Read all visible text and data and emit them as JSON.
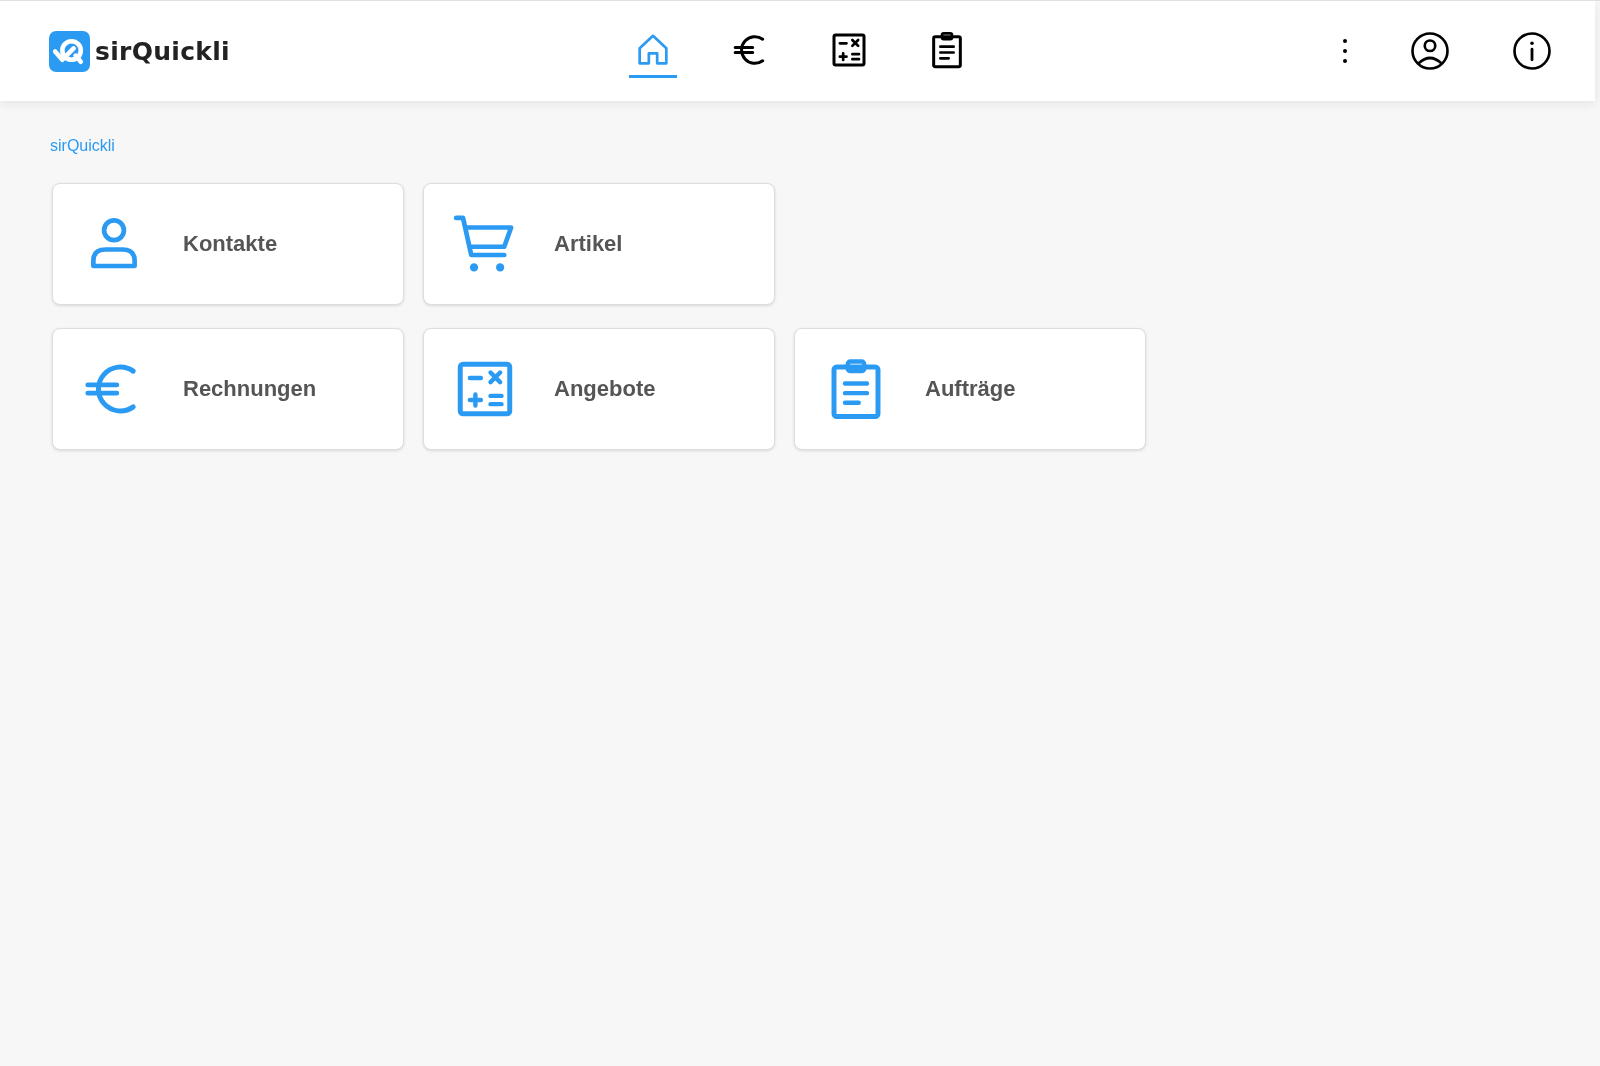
{
  "header": {
    "logo_text": "sirQuickli",
    "nav": [
      {
        "kind": "home",
        "selected": true
      },
      {
        "kind": "euro",
        "selected": false
      },
      {
        "kind": "calculator",
        "selected": false
      },
      {
        "kind": "clipboard",
        "selected": false
      }
    ],
    "actions": [
      {
        "kind": "more"
      },
      {
        "kind": "account"
      },
      {
        "kind": "info"
      }
    ]
  },
  "breadcrumb": "sirQuickli",
  "tile_rows": [
    [
      {
        "kind": "person",
        "label": "Kontakte"
      },
      {
        "kind": "cart",
        "label": "Artikel"
      }
    ],
    [
      {
        "kind": "euro",
        "label": "Rechnungen"
      },
      {
        "kind": "calculator",
        "label": "Angebote"
      },
      {
        "kind": "clipboard",
        "label": "Aufträge"
      }
    ]
  ]
}
